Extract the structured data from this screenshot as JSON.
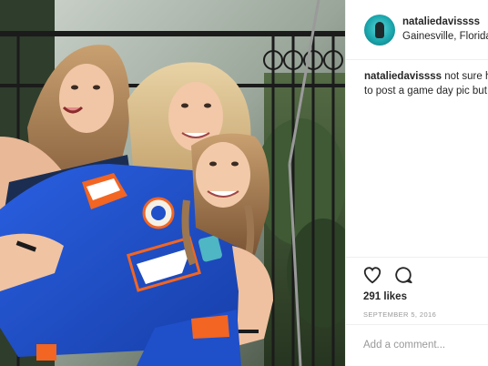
{
  "post": {
    "username": "nataliedavissss",
    "location": "Gainesville, Florida",
    "caption_user": "nataliedavissss",
    "caption_line1": " not sure ho",
    "caption_line2": "to post a game day pic but",
    "likes": "291 likes",
    "date": "SEPTEMBER 5, 2016",
    "comment_placeholder": "Add a comment..."
  },
  "icons": {
    "heart": "heart-icon",
    "comment": "comment-icon"
  },
  "colors": {
    "jersey_blue": "#1f4fc9",
    "jersey_orange": "#f26522",
    "text": "#262626",
    "muted": "#999999"
  }
}
